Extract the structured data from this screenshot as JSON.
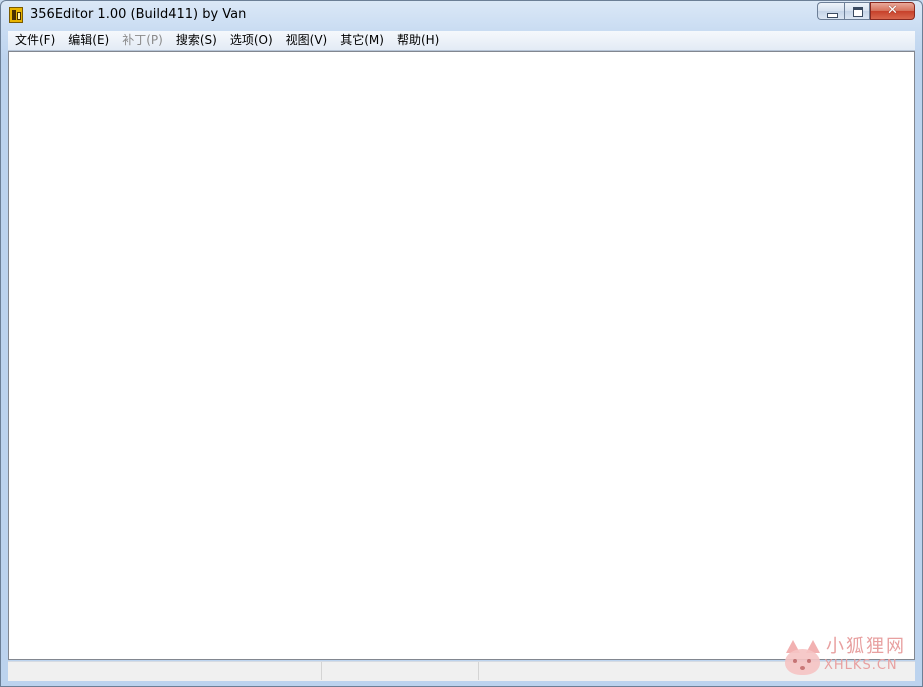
{
  "window": {
    "title": "356Editor 1.00 (Build411) by Van",
    "app_icon": "editor-app-icon",
    "caption_buttons": {
      "minimize_icon": "minimize-icon",
      "maximize_icon": "maximize-icon",
      "close_icon": "close-icon",
      "close_glyph": "✕"
    }
  },
  "menubar": {
    "items": [
      {
        "label": "文件(F)",
        "enabled": true
      },
      {
        "label": "编辑(E)",
        "enabled": true
      },
      {
        "label": "补丁(P)",
        "enabled": false
      },
      {
        "label": "搜索(S)",
        "enabled": true
      },
      {
        "label": "选项(O)",
        "enabled": true
      },
      {
        "label": "视图(V)",
        "enabled": true
      },
      {
        "label": "其它(M)",
        "enabled": true
      },
      {
        "label": "帮助(H)",
        "enabled": true
      }
    ]
  },
  "editor": {
    "content": ""
  },
  "statusbar": {
    "panes": [
      "",
      "",
      ""
    ]
  },
  "watermark": {
    "logo": "fox-logo-icon",
    "text_cn": "小狐狸网",
    "text_en": "XHLKS.CN"
  },
  "colors": {
    "close_button": "#c7402a",
    "client_background": "#ffffff",
    "frame": "#bcd3ee",
    "watermark": "#e8a0a0"
  }
}
